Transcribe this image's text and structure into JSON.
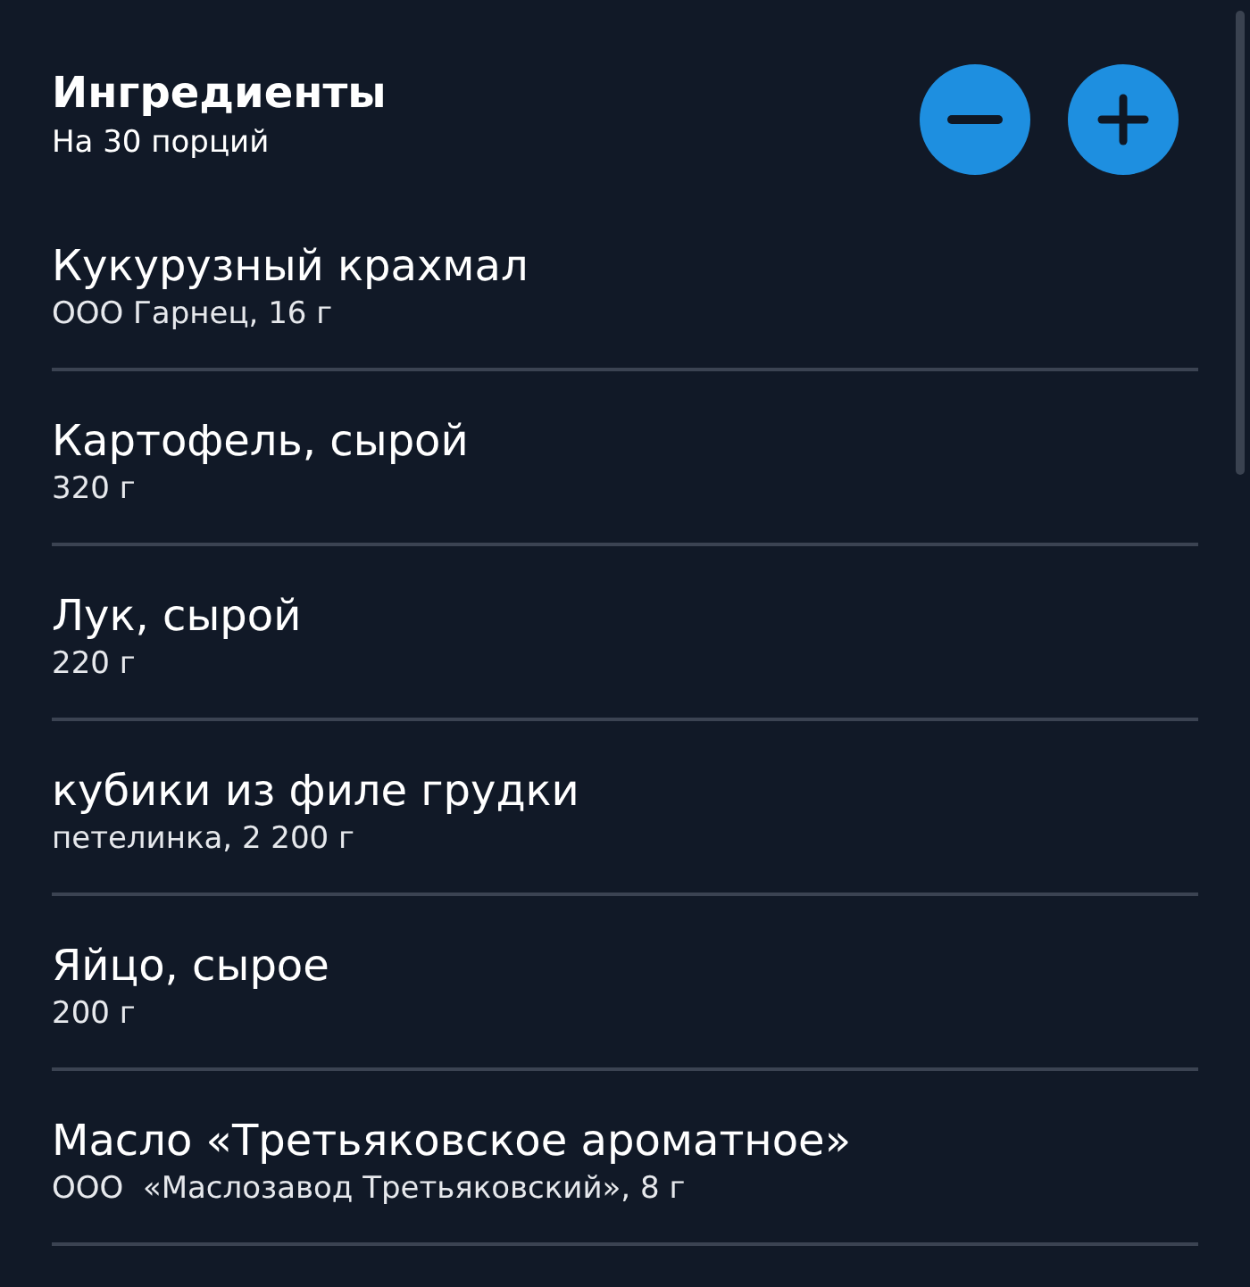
{
  "header": {
    "title": "Ингредиенты",
    "subtitle": "На 30 порций",
    "buttons": [
      {
        "kind": "minus"
      },
      {
        "kind": "plus"
      }
    ]
  },
  "ingredients": [
    {
      "name": "Кукурузный крахмал",
      "detail": "ООО Гарнец, 16 г"
    },
    {
      "name": "Картофель, сырой",
      "detail": "320 г"
    },
    {
      "name": "Лук, сырой",
      "detail": "220 г"
    },
    {
      "name": "кубики из филе грудки",
      "detail": "петелинка, 2 200 г"
    },
    {
      "name": "Яйцо, сырое",
      "detail": "200 г"
    },
    {
      "name": "Масло «Третьяковское ароматное»",
      "detail": "ООО  «Маслозавод Третьяковский», 8 г"
    }
  ]
}
